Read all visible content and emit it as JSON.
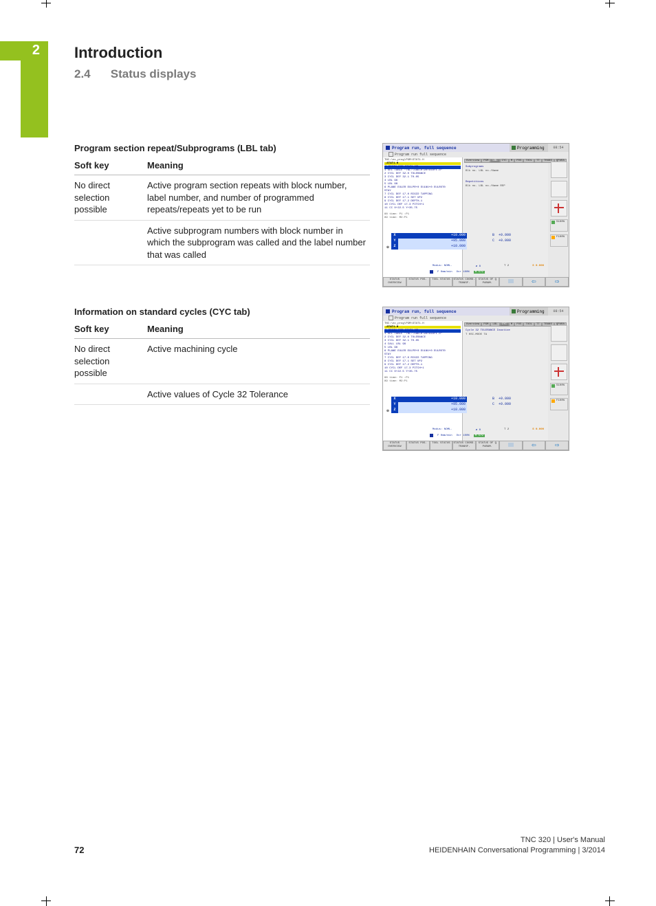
{
  "chapter": {
    "number": "2",
    "title": "Introduction"
  },
  "section": {
    "number": "2.4",
    "title": "Status displays"
  },
  "blocks": [
    {
      "heading": "Program section repeat/Subprograms (LBL tab)",
      "headers": {
        "c1": "Soft key",
        "c2": "Meaning"
      },
      "rows": [
        {
          "c1": "No direct selection possible",
          "c2": "Active program section repeats with block number, label number, and number of programmed repeats/repeats yet to be run"
        },
        {
          "c1": "",
          "c2": "Active subprogram numbers with block number in which the subprogram was called and the label number that was called"
        }
      ],
      "screenshot": {
        "title_left": "Program run, full sequence",
        "subtitle": "Program run full sequence",
        "title_mid": "Programming",
        "topright": "08:54",
        "path": "TNC:\\nc_prog\\PGM\\STAT1.H",
        "progname": "→STAT1.H",
        "first_line": "0  BEGIN PGM STAT1 MM",
        "lines": [
          "1  SEL TABLE \"TNC:\\table\\zeroshft.d\"",
          "2  CYCL DEF 32.0 TOLERANCE",
          "3  CYCL DEF 32.1 T0.05",
          "4  LBL 99",
          "5  LBL 98",
          "6  PLANE EULER EULPR+0 EULNU+0 EULROT0",
          "   STAY",
          "7  CYCL DEF 17.0 RIGID TAPPING",
          "8  CYCL DEF 17.1 SET UP2",
          "9  CYCL DEF 17.2 DEPTH-1",
          "10 CYCL DEF 17.3 PITCH+1",
          "11 CC  X+22.5  Y+35.75"
        ],
        "dist_lines": [
          "88 time: P1  :P1",
          "89 time: M2:P1"
        ],
        "tabs": [
          "Overview",
          "PGM",
          "LBL",
          "CYC",
          "M",
          "POS",
          "TOOL",
          "TT",
          "TRANS",
          "QPARA"
        ],
        "active_tab": "LBL",
        "panel_a": {
          "hdr": "Subprograms",
          "cols": "Blk no.    LBL no./Name"
        },
        "panel_b": {
          "hdr": "Repetitions",
          "cols": "Blk no.   LBL no./Name        REP"
        },
        "axes": [
          {
            "lab": "X",
            "val": "+10.000",
            "hl": true
          },
          {
            "lab": "Y",
            "val": "+95.000",
            "hl": false
          },
          {
            "lab": "Z",
            "val": "+10.000",
            "hl": false
          }
        ],
        "axes2": [
          {
            "lab": "B",
            "val": "+0.000"
          },
          {
            "lab": "C",
            "val": "+0.000"
          }
        ],
        "status": {
          "mode": "Modus: NOML.",
          "dia": "⌀ 8",
          "t": "T 2",
          "s": "S 0.000"
        },
        "ovr": {
          "a": "F 0mm/min",
          "b": "Ovr 100%",
          "c": "M 5/9"
        },
        "softkeys": [
          "STATUS OVERVIEW",
          "STATUS POS.",
          "TOOL STATUS",
          "STATUS COORD. TRANSF.",
          "STATUS OF Q PARAM.",
          "",
          "",
          ""
        ],
        "side_ov": [
          "S100%",
          "F100%"
        ]
      }
    },
    {
      "heading": "Information on standard cycles (CYC tab)",
      "headers": {
        "c1": "Soft key",
        "c2": "Meaning"
      },
      "rows": [
        {
          "c1": "No direct selection possible",
          "c2": "Active machining cycle"
        },
        {
          "c1": "",
          "c2": "Active values of Cycle 32 Tolerance"
        }
      ],
      "screenshot": {
        "title_left": "Program run, full sequence",
        "subtitle": "Program run full sequence",
        "title_mid": "Programming",
        "topright": "08:54",
        "path": "TNC:\\nc_prog\\PGM\\STAT1.H",
        "progname": "→STAT1.H",
        "first_line": "0  BEGIN PGM STAT1 MM",
        "lines": [
          "1  SEL TABLE \"TNC:\\table\\zeroshft.d\"",
          "2  CYCL DEF 32.0 TOLERANCE",
          "3  CYCL DEF 32.1 T0.05",
          "4  CALL LBL 99",
          "5  LBL 99",
          "6  PLANE EULER EULPR+0 EULNU+0 EULROT0",
          "   STAY",
          "7  CYCL DEF 17.0 RIGID TAPPING",
          "8  CYCL DEF 17.1 SET UP2",
          "9  CYCL DEF 17.2 DEPTH-1",
          "10 CYCL DEF 17.3 PITCH+1",
          "11 CC  X+22.5  Y+35.75"
        ],
        "dist_lines": [
          "88 time: P1  :P1",
          "89 time: M2:P1"
        ],
        "tabs": [
          "Overview",
          "PGM",
          "LBL",
          "CYC",
          "M",
          "POS",
          "TOOL",
          "TT",
          "TRANS",
          "QPARA"
        ],
        "active_tab": "CYC",
        "panel_a": {
          "hdr": "Cycle 32 TOLERANCE Inactive",
          "cols": "T     HSC-MODE     TA"
        },
        "panel_b": {
          "hdr": "",
          "cols": ""
        },
        "axes": [
          {
            "lab": "X",
            "val": "+10.000",
            "hl": true
          },
          {
            "lab": "Y",
            "val": "+95.000",
            "hl": false
          },
          {
            "lab": "Z",
            "val": "+10.000",
            "hl": false
          }
        ],
        "axes2": [
          {
            "lab": "B",
            "val": "+0.000"
          },
          {
            "lab": "C",
            "val": "+0.000"
          }
        ],
        "status": {
          "mode": "Modus: NOML.",
          "dia": "⌀ 8",
          "t": "T 2",
          "s": "S 0.000"
        },
        "ovr": {
          "a": "F 0mm/min",
          "b": "Ovr 100%",
          "c": "M 5/9"
        },
        "softkeys": [
          "STATUS OVERVIEW",
          "STATUS POS.",
          "TOOL STATUS",
          "STATUS COORD. TRANSF.",
          "STATUS OF Q PARAM.",
          "",
          "",
          ""
        ],
        "side_ov": [
          "S100%",
          "F100%"
        ]
      }
    }
  ],
  "footer": {
    "page": "72",
    "line1": "TNC 320 | User's Manual",
    "line2": "HEIDENHAIN Conversational Programming | 3/2014"
  }
}
